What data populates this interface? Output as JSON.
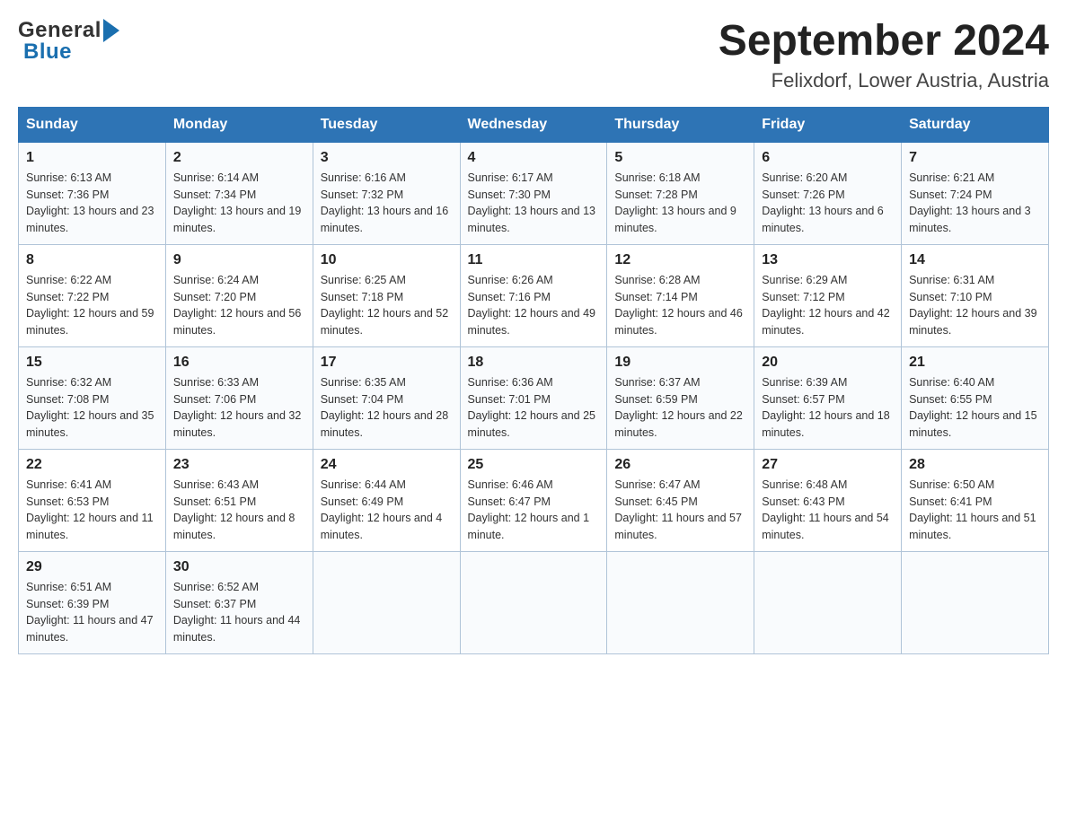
{
  "header": {
    "logo_general": "General",
    "logo_blue": "Blue",
    "title": "September 2024",
    "subtitle": "Felixdorf, Lower Austria, Austria"
  },
  "days_of_week": [
    "Sunday",
    "Monday",
    "Tuesday",
    "Wednesday",
    "Thursday",
    "Friday",
    "Saturday"
  ],
  "weeks": [
    [
      {
        "day": "1",
        "sunrise": "6:13 AM",
        "sunset": "7:36 PM",
        "daylight": "13 hours and 23 minutes."
      },
      {
        "day": "2",
        "sunrise": "6:14 AM",
        "sunset": "7:34 PM",
        "daylight": "13 hours and 19 minutes."
      },
      {
        "day": "3",
        "sunrise": "6:16 AM",
        "sunset": "7:32 PM",
        "daylight": "13 hours and 16 minutes."
      },
      {
        "day": "4",
        "sunrise": "6:17 AM",
        "sunset": "7:30 PM",
        "daylight": "13 hours and 13 minutes."
      },
      {
        "day": "5",
        "sunrise": "6:18 AM",
        "sunset": "7:28 PM",
        "daylight": "13 hours and 9 minutes."
      },
      {
        "day": "6",
        "sunrise": "6:20 AM",
        "sunset": "7:26 PM",
        "daylight": "13 hours and 6 minutes."
      },
      {
        "day": "7",
        "sunrise": "6:21 AM",
        "sunset": "7:24 PM",
        "daylight": "13 hours and 3 minutes."
      }
    ],
    [
      {
        "day": "8",
        "sunrise": "6:22 AM",
        "sunset": "7:22 PM",
        "daylight": "12 hours and 59 minutes."
      },
      {
        "day": "9",
        "sunrise": "6:24 AM",
        "sunset": "7:20 PM",
        "daylight": "12 hours and 56 minutes."
      },
      {
        "day": "10",
        "sunrise": "6:25 AM",
        "sunset": "7:18 PM",
        "daylight": "12 hours and 52 minutes."
      },
      {
        "day": "11",
        "sunrise": "6:26 AM",
        "sunset": "7:16 PM",
        "daylight": "12 hours and 49 minutes."
      },
      {
        "day": "12",
        "sunrise": "6:28 AM",
        "sunset": "7:14 PM",
        "daylight": "12 hours and 46 minutes."
      },
      {
        "day": "13",
        "sunrise": "6:29 AM",
        "sunset": "7:12 PM",
        "daylight": "12 hours and 42 minutes."
      },
      {
        "day": "14",
        "sunrise": "6:31 AM",
        "sunset": "7:10 PM",
        "daylight": "12 hours and 39 minutes."
      }
    ],
    [
      {
        "day": "15",
        "sunrise": "6:32 AM",
        "sunset": "7:08 PM",
        "daylight": "12 hours and 35 minutes."
      },
      {
        "day": "16",
        "sunrise": "6:33 AM",
        "sunset": "7:06 PM",
        "daylight": "12 hours and 32 minutes."
      },
      {
        "day": "17",
        "sunrise": "6:35 AM",
        "sunset": "7:04 PM",
        "daylight": "12 hours and 28 minutes."
      },
      {
        "day": "18",
        "sunrise": "6:36 AM",
        "sunset": "7:01 PM",
        "daylight": "12 hours and 25 minutes."
      },
      {
        "day": "19",
        "sunrise": "6:37 AM",
        "sunset": "6:59 PM",
        "daylight": "12 hours and 22 minutes."
      },
      {
        "day": "20",
        "sunrise": "6:39 AM",
        "sunset": "6:57 PM",
        "daylight": "12 hours and 18 minutes."
      },
      {
        "day": "21",
        "sunrise": "6:40 AM",
        "sunset": "6:55 PM",
        "daylight": "12 hours and 15 minutes."
      }
    ],
    [
      {
        "day": "22",
        "sunrise": "6:41 AM",
        "sunset": "6:53 PM",
        "daylight": "12 hours and 11 minutes."
      },
      {
        "day": "23",
        "sunrise": "6:43 AM",
        "sunset": "6:51 PM",
        "daylight": "12 hours and 8 minutes."
      },
      {
        "day": "24",
        "sunrise": "6:44 AM",
        "sunset": "6:49 PM",
        "daylight": "12 hours and 4 minutes."
      },
      {
        "day": "25",
        "sunrise": "6:46 AM",
        "sunset": "6:47 PM",
        "daylight": "12 hours and 1 minute."
      },
      {
        "day": "26",
        "sunrise": "6:47 AM",
        "sunset": "6:45 PM",
        "daylight": "11 hours and 57 minutes."
      },
      {
        "day": "27",
        "sunrise": "6:48 AM",
        "sunset": "6:43 PM",
        "daylight": "11 hours and 54 minutes."
      },
      {
        "day": "28",
        "sunrise": "6:50 AM",
        "sunset": "6:41 PM",
        "daylight": "11 hours and 51 minutes."
      }
    ],
    [
      {
        "day": "29",
        "sunrise": "6:51 AM",
        "sunset": "6:39 PM",
        "daylight": "11 hours and 47 minutes."
      },
      {
        "day": "30",
        "sunrise": "6:52 AM",
        "sunset": "6:37 PM",
        "daylight": "11 hours and 44 minutes."
      },
      null,
      null,
      null,
      null,
      null
    ]
  ],
  "labels": {
    "sunrise": "Sunrise:",
    "sunset": "Sunset:",
    "daylight": "Daylight:"
  }
}
